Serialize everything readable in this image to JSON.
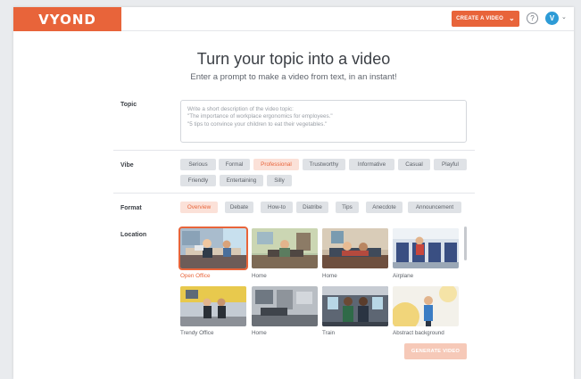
{
  "header": {
    "logo_text": "VYOND",
    "create_label": "CREATE A VIDEO",
    "help_symbol": "?",
    "avatar_initial": "V"
  },
  "hero": {
    "title": "Turn your topic into a video",
    "subtitle": "Enter a prompt to make a video from text, in an instant!"
  },
  "topic": {
    "label": "Topic",
    "placeholder_lines": [
      "Write a short description of the video topic:",
      "\"The importance of workplace ergonomics for employees.\"",
      "\"5 tips to convince your children to eat their vegetables.\""
    ]
  },
  "vibe": {
    "label": "Vibe",
    "options": [
      "Serious",
      "Formal",
      "Professional",
      "Trustworthy",
      "Informative",
      "Casual",
      "Playful",
      "Friendly",
      "Entertaining",
      "Silly"
    ],
    "selected": "Professional"
  },
  "format": {
    "label": "Format",
    "options": [
      "Overview",
      "Debate",
      "How-to",
      "Diatribe",
      "Tips",
      "Anecdote",
      "Announcement"
    ],
    "selected": "Overview"
  },
  "location": {
    "label": "Location",
    "tiles": [
      {
        "name": "Open Office",
        "selected": true
      },
      {
        "name": "Home",
        "selected": false
      },
      {
        "name": "Home",
        "selected": false
      },
      {
        "name": "Airplane",
        "selected": false
      },
      {
        "name": "Trendy Office",
        "selected": false
      },
      {
        "name": "Home",
        "selected": false
      },
      {
        "name": "Train",
        "selected": false
      },
      {
        "name": "Abstract background",
        "selected": false
      }
    ]
  },
  "generate_label": "GENERATE VIDEO",
  "colors": {
    "accent": "#e8643a",
    "chip_bg": "#dfe2e6",
    "chip_selected_bg": "#fbe1d8",
    "avatar": "#2d9bd6"
  }
}
